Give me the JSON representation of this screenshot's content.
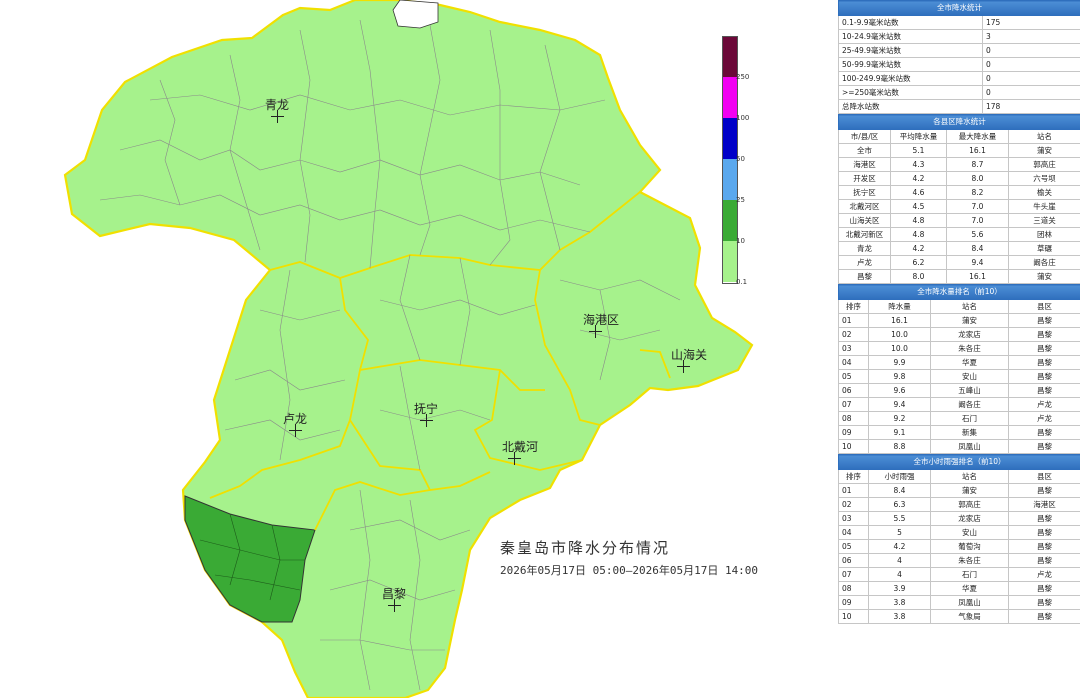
{
  "map": {
    "title": "秦皇岛市降水分布情况",
    "period": "2026年05月17日 05:00—2026年05月17日 14:00",
    "cities": [
      {
        "name": "青龙"
      },
      {
        "name": "海港区"
      },
      {
        "name": "山海关"
      },
      {
        "name": "卢龙"
      },
      {
        "name": "抚宁"
      },
      {
        "name": "北戴河"
      },
      {
        "name": "昌黎"
      }
    ],
    "colors": {
      "low": "#a6f28c",
      "mid": "#3aaa35",
      "boundary": "#f0e000",
      "outside": "#ffffff"
    }
  },
  "legend": {
    "ticks": [
      "250",
      "100",
      "50",
      "25",
      "10",
      "0.1"
    ],
    "colors": [
      "#6b0838",
      "#f200f2",
      "#0000c8",
      "#5aa8ee",
      "#3aaa35",
      "#a6f28c"
    ]
  },
  "panel": {
    "summary": {
      "title": "全市降水统计",
      "rows": [
        {
          "label": "0.1-9.9毫米站数",
          "value": "175"
        },
        {
          "label": "10-24.9毫米站数",
          "value": "3"
        },
        {
          "label": "25-49.9毫米站数",
          "value": "0"
        },
        {
          "label": "50-99.9毫米站数",
          "value": "0"
        },
        {
          "label": "100-249.9毫米站数",
          "value": "0"
        },
        {
          "label": ">=250毫米站数",
          "value": "0"
        },
        {
          "label": "总降水站数",
          "value": "178"
        }
      ]
    },
    "county": {
      "title": "各县区降水统计",
      "headers": [
        "市/县/区",
        "平均降水量",
        "最大降水量",
        "站名"
      ],
      "rows": [
        [
          "全市",
          "5.1",
          "16.1",
          "蒲安"
        ],
        [
          "海港区",
          "4.3",
          "8.7",
          "郭高庄"
        ],
        [
          "开发区",
          "4.2",
          "8.0",
          "六号坝"
        ],
        [
          "抚宁区",
          "4.6",
          "8.2",
          "榆关"
        ],
        [
          "北戴河区",
          "4.5",
          "7.0",
          "牛头崖"
        ],
        [
          "山海关区",
          "4.8",
          "7.0",
          "三道关"
        ],
        [
          "北戴河新区",
          "4.8",
          "5.6",
          "团林"
        ],
        [
          "青龙",
          "4.2",
          "8.4",
          "草碾"
        ],
        [
          "卢龙",
          "6.2",
          "9.4",
          "阚各庄"
        ],
        [
          "昌黎",
          "8.0",
          "16.1",
          "蒲安"
        ]
      ]
    },
    "ranking": {
      "title": "全市降水量排名（前10）",
      "headers": [
        "排序",
        "降水量",
        "站名",
        "县区"
      ],
      "rows": [
        [
          "01",
          "16.1",
          "蒲安",
          "昌黎"
        ],
        [
          "02",
          "10.0",
          "龙家店",
          "昌黎"
        ],
        [
          "03",
          "10.0",
          "朱各庄",
          "昌黎"
        ],
        [
          "04",
          "9.9",
          "华夏",
          "昌黎"
        ],
        [
          "05",
          "9.8",
          "安山",
          "昌黎"
        ],
        [
          "06",
          "9.6",
          "五峰山",
          "昌黎"
        ],
        [
          "07",
          "9.4",
          "阚各庄",
          "卢龙"
        ],
        [
          "08",
          "9.2",
          "石门",
          "卢龙"
        ],
        [
          "09",
          "9.1",
          "新集",
          "昌黎"
        ],
        [
          "10",
          "8.8",
          "凤凰山",
          "昌黎"
        ]
      ]
    },
    "hourly": {
      "title": "全市小时雨强排名（前10）",
      "headers": [
        "排序",
        "小时雨强",
        "站名",
        "县区"
      ],
      "rows": [
        [
          "01",
          "8.4",
          "蒲安",
          "昌黎"
        ],
        [
          "02",
          "6.3",
          "郭高庄",
          "海港区"
        ],
        [
          "03",
          "5.5",
          "龙家店",
          "昌黎"
        ],
        [
          "04",
          "5",
          "安山",
          "昌黎"
        ],
        [
          "05",
          "4.2",
          "葡萄沟",
          "昌黎"
        ],
        [
          "06",
          "4",
          "朱各庄",
          "昌黎"
        ],
        [
          "07",
          "4",
          "石门",
          "卢龙"
        ],
        [
          "08",
          "3.9",
          "华夏",
          "昌黎"
        ],
        [
          "09",
          "3.8",
          "凤凰山",
          "昌黎"
        ],
        [
          "10",
          "3.8",
          "气象局",
          "昌黎"
        ]
      ]
    }
  }
}
